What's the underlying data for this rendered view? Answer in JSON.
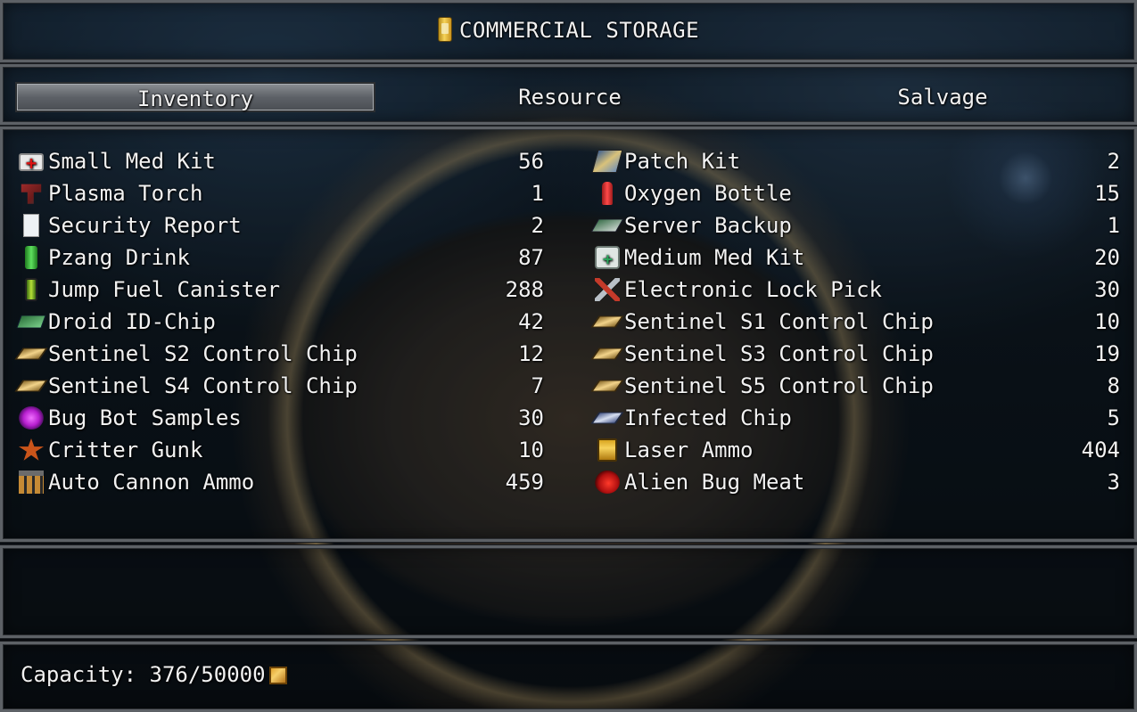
{
  "title": "COMMERCIAL STORAGE",
  "title_icon": "battery-canister-icon",
  "tabs": [
    {
      "label": "Inventory",
      "active": true
    },
    {
      "label": "Resource",
      "active": false
    },
    {
      "label": "Salvage",
      "active": false
    }
  ],
  "items_left": [
    {
      "icon": "small-med-kit-icon",
      "name": "Small Med Kit",
      "qty": "56"
    },
    {
      "icon": "plasma-torch-icon",
      "name": "Plasma Torch",
      "qty": "1"
    },
    {
      "icon": "security-report-icon",
      "name": "Security Report",
      "qty": "2"
    },
    {
      "icon": "pzang-drink-icon",
      "name": "Pzang Drink",
      "qty": "87"
    },
    {
      "icon": "jump-fuel-canister-icon",
      "name": "Jump Fuel Canister",
      "qty": "288"
    },
    {
      "icon": "droid-id-chip-icon",
      "name": "Droid ID-Chip",
      "qty": "42"
    },
    {
      "icon": "control-chip-icon",
      "name": "Sentinel S2 Control Chip",
      "qty": "12"
    },
    {
      "icon": "control-chip-icon",
      "name": "Sentinel S4 Control Chip",
      "qty": "7"
    },
    {
      "icon": "bug-bot-samples-icon",
      "name": "Bug Bot Samples",
      "qty": "30"
    },
    {
      "icon": "critter-gunk-icon",
      "name": "Critter Gunk",
      "qty": "10"
    },
    {
      "icon": "auto-cannon-ammo-icon",
      "name": "Auto Cannon Ammo",
      "qty": "459"
    }
  ],
  "items_right": [
    {
      "icon": "patch-kit-icon",
      "name": "Patch Kit",
      "qty": "2"
    },
    {
      "icon": "oxygen-bottle-icon",
      "name": "Oxygen Bottle",
      "qty": "15"
    },
    {
      "icon": "server-backup-icon",
      "name": "Server Backup",
      "qty": "1"
    },
    {
      "icon": "medium-med-kit-icon",
      "name": "Medium Med Kit",
      "qty": "20"
    },
    {
      "icon": "electronic-lock-pick-icon",
      "name": "Electronic Lock Pick",
      "qty": "30"
    },
    {
      "icon": "control-chip-icon",
      "name": "Sentinel S1 Control Chip",
      "qty": "10"
    },
    {
      "icon": "control-chip-icon",
      "name": "Sentinel S3 Control Chip",
      "qty": "19"
    },
    {
      "icon": "control-chip-icon",
      "name": "Sentinel S5 Control Chip",
      "qty": "8"
    },
    {
      "icon": "infected-chip-icon",
      "name": "Infected Chip",
      "qty": "5"
    },
    {
      "icon": "laser-ammo-icon",
      "name": "Laser Ammo",
      "qty": "404"
    },
    {
      "icon": "alien-bug-meat-icon",
      "name": "Alien Bug Meat",
      "qty": "3"
    }
  ],
  "capacity": {
    "text": "Capacity: 376/50000",
    "icon": "crate-icon"
  }
}
